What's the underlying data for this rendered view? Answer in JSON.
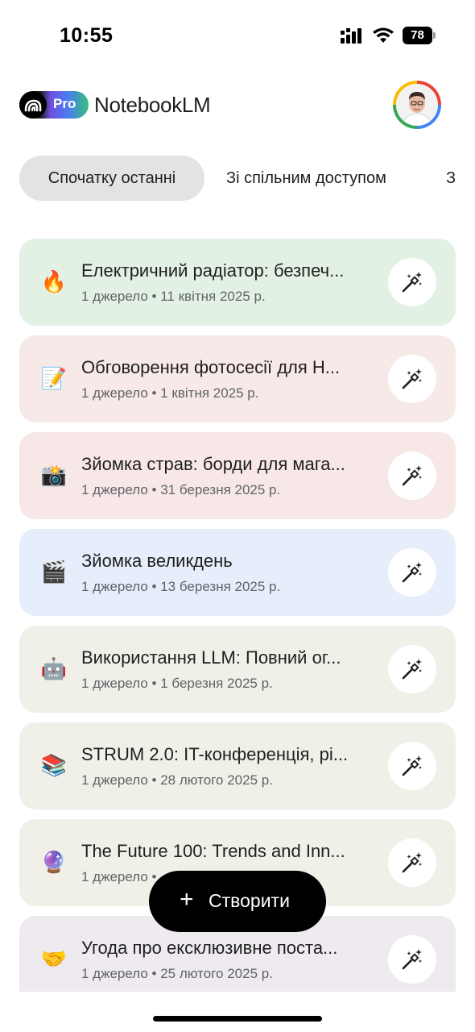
{
  "status_bar": {
    "time": "10:55",
    "battery": "78"
  },
  "header": {
    "app_name": "NotebookLM",
    "badge": "Pro"
  },
  "filters": [
    {
      "label": "Спочатку останні",
      "active": true
    },
    {
      "label": "Зі спільним доступом",
      "active": false
    },
    {
      "label": "З",
      "active": false
    }
  ],
  "notebooks": [
    {
      "emoji": "🔥",
      "title": "Електричний радіатор: безпеч...",
      "meta": "1 джерело • 11 квітня 2025 р.",
      "color": "#e3f1e4"
    },
    {
      "emoji": "📝",
      "title": "Обговорення фотосесії для Н...",
      "meta": "1 джерело • 1 квітня 2025 р.",
      "color": "#f7e9e7"
    },
    {
      "emoji": "📸",
      "title": "Зйомка страв: борди для мага...",
      "meta": "1 джерело • 31 березня 2025 р.",
      "color": "#f7e8e7"
    },
    {
      "emoji": "🎬",
      "title": "Зйомка великдень",
      "meta": "1 джерело • 13 березня 2025 р.",
      "color": "#e6eefb"
    },
    {
      "emoji": "🤖",
      "title": "Використання LLM: Повний ог...",
      "meta": "1 джерело • 1 березня 2025 р.",
      "color": "#f0f0e8"
    },
    {
      "emoji": "📚",
      "title": "STRUM 2.0: IT-конференція, рі...",
      "meta": "1 джерело • 28 лютого 2025 р.",
      "color": "#f0f0e8"
    },
    {
      "emoji": "🔮",
      "title": "The Future 100: Trends and Inn...",
      "meta": "1 джерело • ...",
      "color": "#f0f0e8"
    },
    {
      "emoji": "🤝",
      "title": "Угода про ексклюзивне поста...",
      "meta": "1 джерело • 25 лютого 2025 р.",
      "color": "#eeeaf0"
    }
  ],
  "fab": {
    "label": "Створити"
  },
  "icons": {
    "card_action": "magic-wand-icon",
    "fab": "plus-icon",
    "logo": "notebooklm-logo"
  }
}
